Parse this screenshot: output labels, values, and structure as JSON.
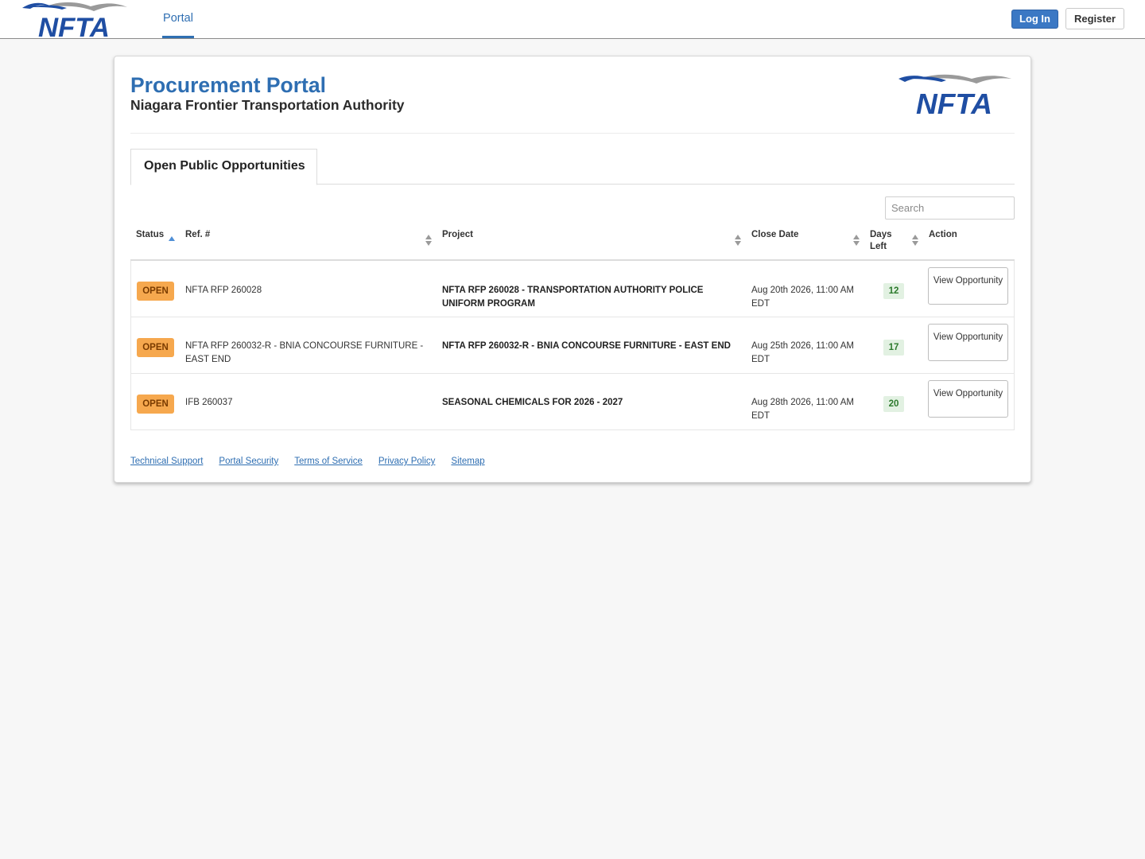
{
  "nav": {
    "logo_text": "NFTA",
    "portal_tab": "Portal",
    "login_label": "Log In",
    "register_label": "Register"
  },
  "header": {
    "title": "Procurement Portal",
    "subtitle": "Niagara Frontier Transportation Authority",
    "logo_text": "NFTA"
  },
  "tabs": [
    {
      "label": "Open Public Opportunities"
    }
  ],
  "search": {
    "placeholder": "Search"
  },
  "table": {
    "columns": [
      "Status",
      "Ref. #",
      "Project",
      "Close Date",
      "Days Left",
      "Action"
    ],
    "rows": [
      {
        "status": "OPEN",
        "ref": "NFTA RFP 260028",
        "project": "NFTA RFP 260028 - TRANSPORTATION AUTHORITY POLICE UNIFORM PROGRAM",
        "close_date": "Aug 20th 2026, 11:00 AM EDT",
        "days_left": "12",
        "action": "View Opportunity"
      },
      {
        "status": "OPEN",
        "ref": "NFTA RFP 260032-R - BNIA CONCOURSE FURNITURE - EAST END",
        "project": "NFTA RFP 260032-R - BNIA CONCOURSE FURNITURE - EAST END",
        "close_date": "Aug 25th 2026, 11:00 AM EDT",
        "days_left": "17",
        "action": "View Opportunity"
      },
      {
        "status": "OPEN",
        "ref": "IFB 260037",
        "project": "SEASONAL CHEMICALS FOR 2026 - 2027",
        "close_date": "Aug 28th 2026, 11:00 AM EDT",
        "days_left": "20",
        "action": "View Opportunity"
      }
    ]
  },
  "footer": {
    "links": [
      "Technical Support",
      "Portal Security",
      "Terms of Service",
      "Privacy Policy",
      "Sitemap"
    ]
  },
  "colors": {
    "accent": "#2e6eb2",
    "open_badge": "#f6a84e",
    "days_badge": "#e2f1e2",
    "login_button": "#3b78c4"
  },
  "icons": {
    "sort_ascending": "sort-asc-icon",
    "sortable": "sort-icon"
  }
}
